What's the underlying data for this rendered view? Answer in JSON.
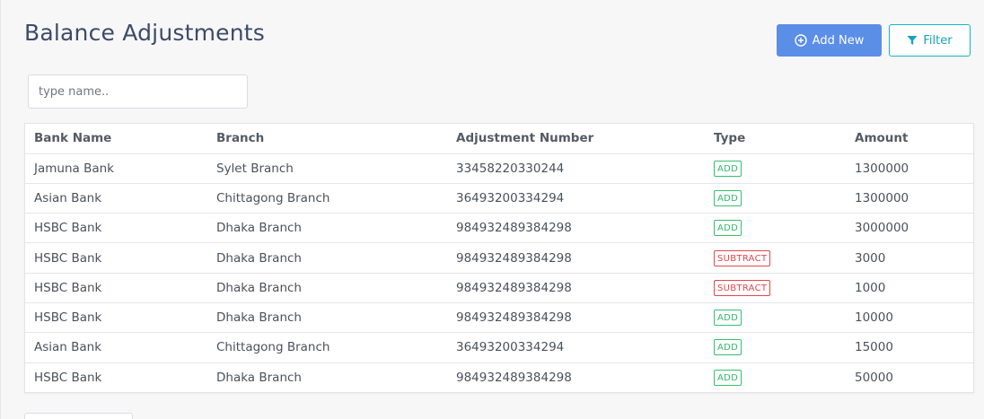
{
  "header": {
    "title": "Balance Adjustments",
    "add_label": "Add New",
    "filter_label": "Filter"
  },
  "search": {
    "placeholder": "type name..",
    "value": ""
  },
  "table": {
    "columns": [
      "Bank Name",
      "Branch",
      "Adjustment Number",
      "Type",
      "Amount"
    ],
    "rows": [
      {
        "bank": "Jamuna Bank",
        "branch": "Sylet Branch",
        "number": "33458220330244",
        "type": "ADD",
        "amount": "1300000"
      },
      {
        "bank": "Asian Bank",
        "branch": "Chittagong Branch",
        "number": "36493200334294",
        "type": "ADD",
        "amount": "1300000"
      },
      {
        "bank": "HSBC Bank",
        "branch": "Dhaka Branch",
        "number": "984932489384298",
        "type": "ADD",
        "amount": "3000000"
      },
      {
        "bank": "HSBC Bank",
        "branch": "Dhaka Branch",
        "number": "984932489384298",
        "type": "SUBTRACT",
        "amount": "3000"
      },
      {
        "bank": "HSBC Bank",
        "branch": "Dhaka Branch",
        "number": "984932489384298",
        "type": "SUBTRACT",
        "amount": "1000"
      },
      {
        "bank": "HSBC Bank",
        "branch": "Dhaka Branch",
        "number": "984932489384298",
        "type": "ADD",
        "amount": "10000"
      },
      {
        "bank": "Asian Bank",
        "branch": "Chittagong Branch",
        "number": "36493200334294",
        "type": "ADD",
        "amount": "15000"
      },
      {
        "bank": "HSBC Bank",
        "branch": "Dhaka Branch",
        "number": "984932489384298",
        "type": "ADD",
        "amount": "50000"
      }
    ]
  },
  "icons": {
    "add": "plus-circle-icon",
    "filter": "funnel-icon"
  },
  "colors": {
    "primary": "#5b8ee6",
    "info": "#17b3c9",
    "add_badge": "#35c06f",
    "subtract_badge": "#e2474f"
  }
}
